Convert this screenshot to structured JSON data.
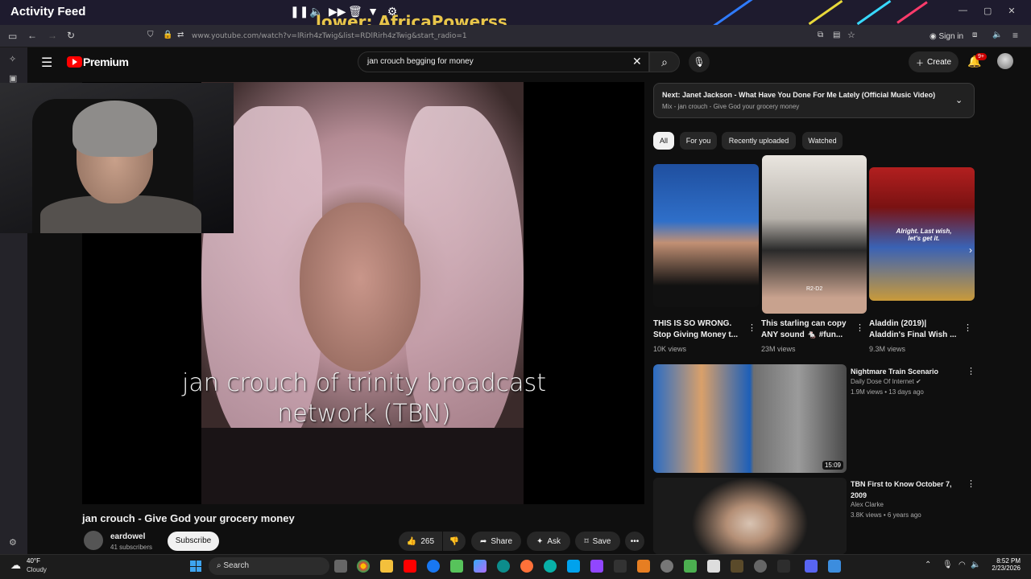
{
  "overlay": {
    "title": "Activity Feed",
    "follower_text": "lower: AfricaPowerss",
    "media_icons": [
      "pause-icon",
      "volume-icon",
      "next-icon",
      "trash-icon",
      "filter-icon",
      "gear-icon"
    ]
  },
  "browser": {
    "url": "www.youtube.com/watch?v=lRirh4zTwig&list=RDlRirh4zTwig&start_radio=1",
    "signin_label": "Sign in"
  },
  "youtube": {
    "logo_text": "Premium",
    "search_value": "jan crouch begging for money",
    "create_label": "Create",
    "notification_badge": "9+"
  },
  "video": {
    "caption": "jan crouch of trinity broadcast network (TBN)",
    "title": "jan crouch - Give God your grocery money",
    "channel_name": "eardowel",
    "channel_subs": "41 subscribers",
    "subscribe_label": "Subscribe",
    "like_count": "265",
    "share_label": "Share",
    "ask_label": "Ask",
    "save_label": "Save"
  },
  "sidebar": {
    "next_title": "Next: Janet Jackson - What Have You Done For Me Lately (Official Music Video)",
    "next_sub": "Mix - jan crouch - Give God your grocery money",
    "chips": [
      "All",
      "For you",
      "Recently uploaded",
      "Watched"
    ],
    "shorts": [
      {
        "title_line1": "THIS IS SO WRONG.",
        "title_line2": "Stop Giving Money t...",
        "views": "10K views"
      },
      {
        "title_line1": "This starling can copy",
        "title_line2": "ANY sound 🐁 #fun...",
        "views": "23M views"
      },
      {
        "title_line1": "Aladdin (2019)|",
        "title_line2": "Aladdin's Final Wish ...",
        "views": "9.3M views"
      }
    ],
    "short3_overlay": "Alright. Last wish, let's get it.",
    "short2_overlay": "R2-D2",
    "videos": [
      {
        "title": "Nightmare Train Scenario",
        "channel": "Daily Dose Of Internet",
        "meta": "1.9M views • 13 days ago",
        "duration": "15:09"
      },
      {
        "title_line1": "TBN First to Know October 7,",
        "title_line2": "2009",
        "channel": "Alex Clarke",
        "meta": "3.8K views • 6 years ago"
      }
    ]
  },
  "taskbar": {
    "temp": "40°F",
    "weather": "Cloudy",
    "search_label": "Search",
    "time": "8:52 PM",
    "date": "2/23/2026"
  }
}
